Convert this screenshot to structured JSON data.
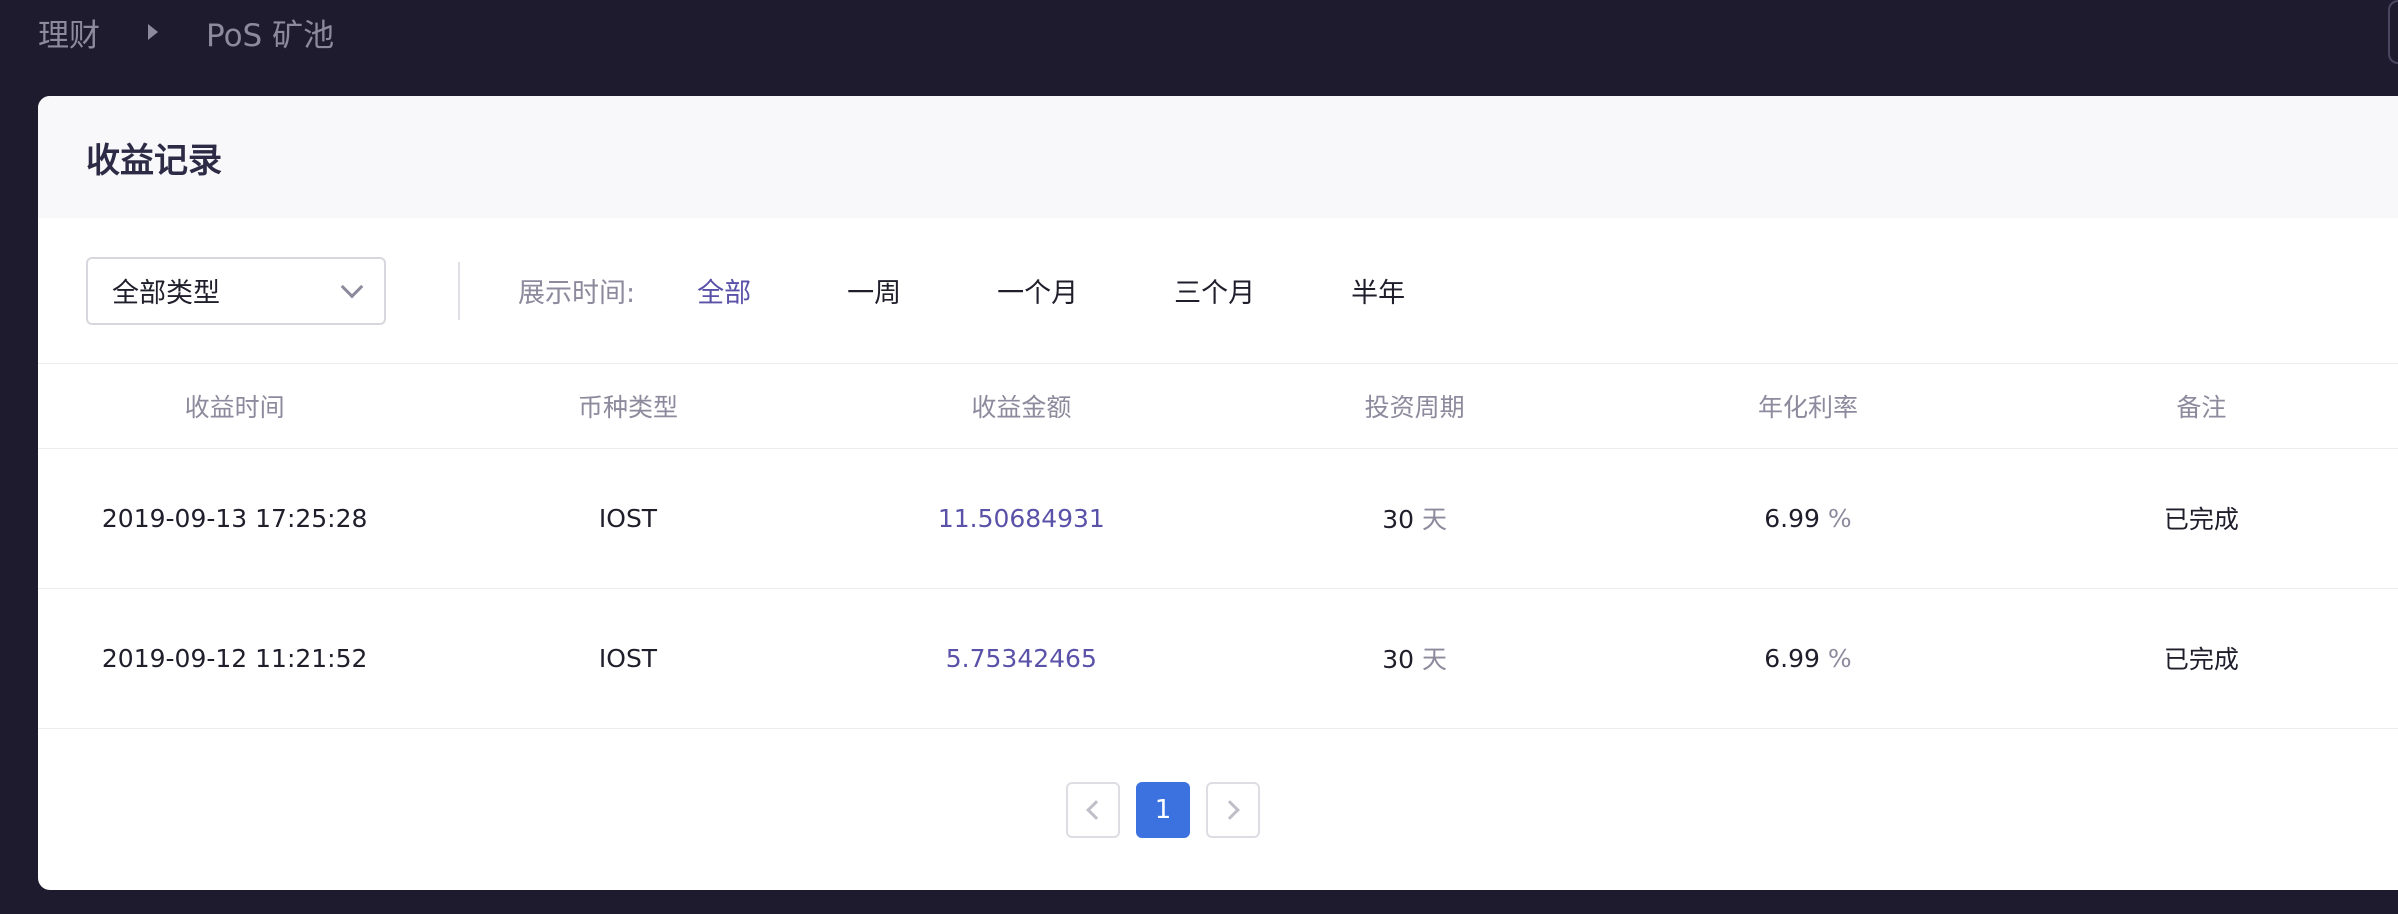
{
  "breadcrumb": {
    "root": "理财",
    "current": "PoS 矿池"
  },
  "card": {
    "title": "收益记录"
  },
  "filters": {
    "type_select": "全部类型",
    "time_label": "展示时间:",
    "periods": [
      {
        "label": "全部",
        "active": true
      },
      {
        "label": "一周",
        "active": false
      },
      {
        "label": "一个月",
        "active": false
      },
      {
        "label": "三个月",
        "active": false
      },
      {
        "label": "半年",
        "active": false
      }
    ]
  },
  "table": {
    "columns": [
      "收益时间",
      "币种类型",
      "收益金额",
      "投资周期",
      "年化利率",
      "备注"
    ],
    "rows": [
      {
        "time": "2019-09-13 17:25:28",
        "coin": "IOST",
        "amount": "11.50684931",
        "period": "30",
        "period_unit": "天",
        "rate": "6.99",
        "rate_unit": "%",
        "note": "已完成"
      },
      {
        "time": "2019-09-12 11:21:52",
        "coin": "IOST",
        "amount": "5.75342465",
        "period": "30",
        "period_unit": "天",
        "rate": "6.99",
        "rate_unit": "%",
        "note": "已完成"
      }
    ]
  },
  "pagination": {
    "current_page": "1"
  },
  "colors": {
    "accent": "#5a52a8",
    "page_active": "#3b72e0",
    "background": "#1e1b2e"
  }
}
